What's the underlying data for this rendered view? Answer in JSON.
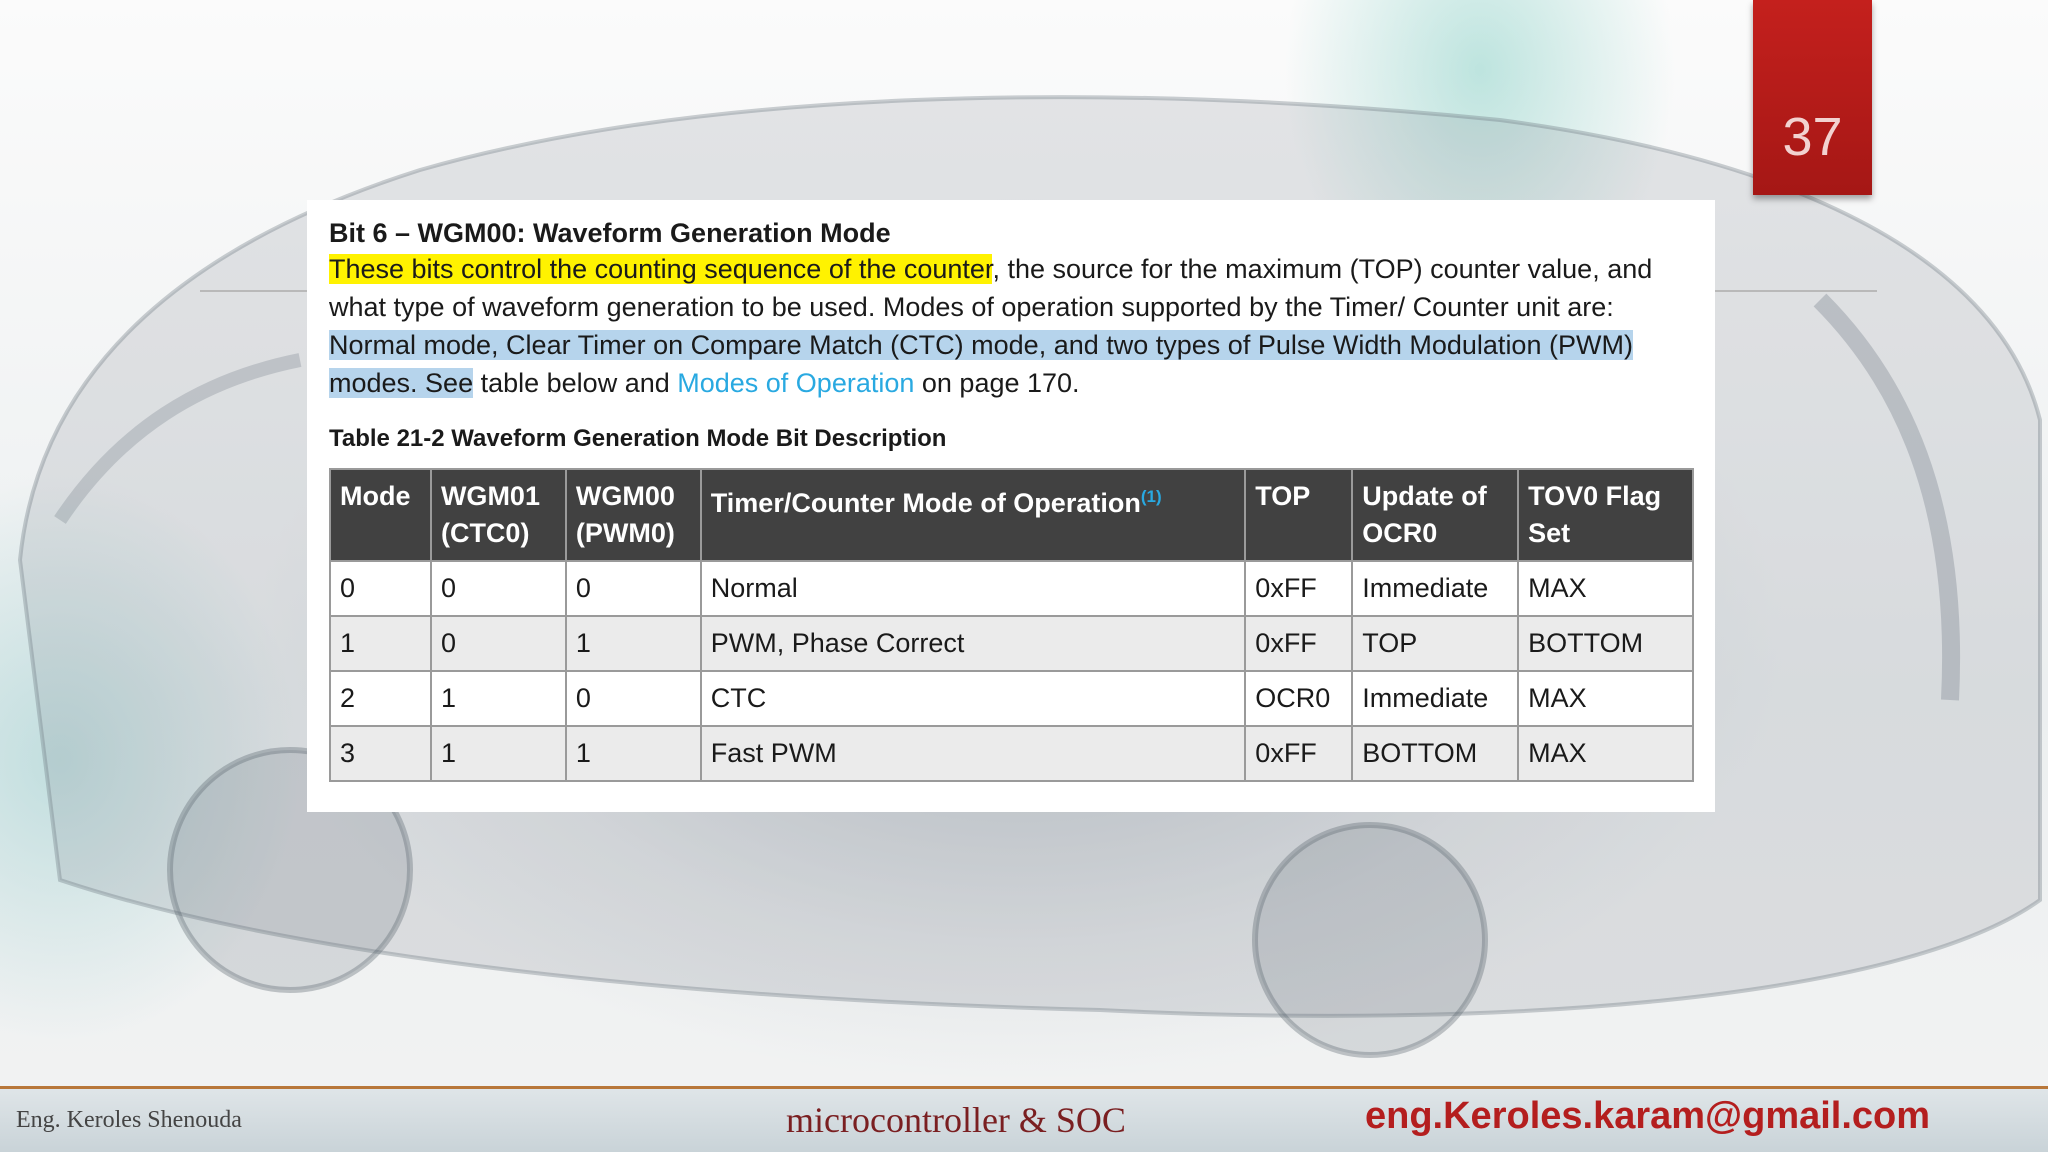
{
  "slide": {
    "page_number": "37"
  },
  "section": {
    "heading": "Bit 6 – WGM00:  Waveform Generation Mode",
    "para_highlight_yellow": "These bits control the counting sequence of the counter",
    "para_text_1": ", the source for the maximum (TOP) counter value, and what type of waveform generation to be used. Modes of operation supported by the Timer/ Counter unit are: ",
    "para_highlight_blue": "Normal mode, Clear Timer on Compare Match (CTC) mode, and two types of Pulse Width Modulation (PWM) modes. See",
    "para_text_2": " table below and ",
    "para_link": "Modes of Operation",
    "para_text_3": " on page 170."
  },
  "table": {
    "caption": "Table 21-2  Waveform Generation Mode Bit Description",
    "headers": {
      "mode": "Mode",
      "wgm01_a": "WGM01",
      "wgm01_b": "(CTC0)",
      "wgm00_a": "WGM00",
      "wgm00_b": "(PWM0)",
      "op": "Timer/Counter Mode of Operation",
      "op_sup": "(1)",
      "top": "TOP",
      "upd_a": "Update of",
      "upd_b": "OCR0",
      "tov_a": "TOV0 Flag",
      "tov_b": "Set"
    },
    "rows": [
      {
        "mode": "0",
        "wgm01": "0",
        "wgm00": "0",
        "op": "Normal",
        "top": "0xFF",
        "update": "Immediate",
        "tov": "MAX"
      },
      {
        "mode": "1",
        "wgm01": "0",
        "wgm00": "1",
        "op": "PWM, Phase Correct",
        "top": "0xFF",
        "update": "TOP",
        "tov": "BOTTOM"
      },
      {
        "mode": "2",
        "wgm01": "1",
        "wgm00": "0",
        "op": "CTC",
        "top": "OCR0",
        "update": "Immediate",
        "tov": "MAX"
      },
      {
        "mode": "3",
        "wgm01": "1",
        "wgm00": "1",
        "op": "Fast PWM",
        "top": "0xFF",
        "update": "BOTTOM",
        "tov": "MAX"
      }
    ]
  },
  "footer": {
    "author": "Eng. Keroles Shenouda",
    "course": "microcontroller & SOC",
    "email": "eng.Keroles.karam@gmail.com"
  }
}
